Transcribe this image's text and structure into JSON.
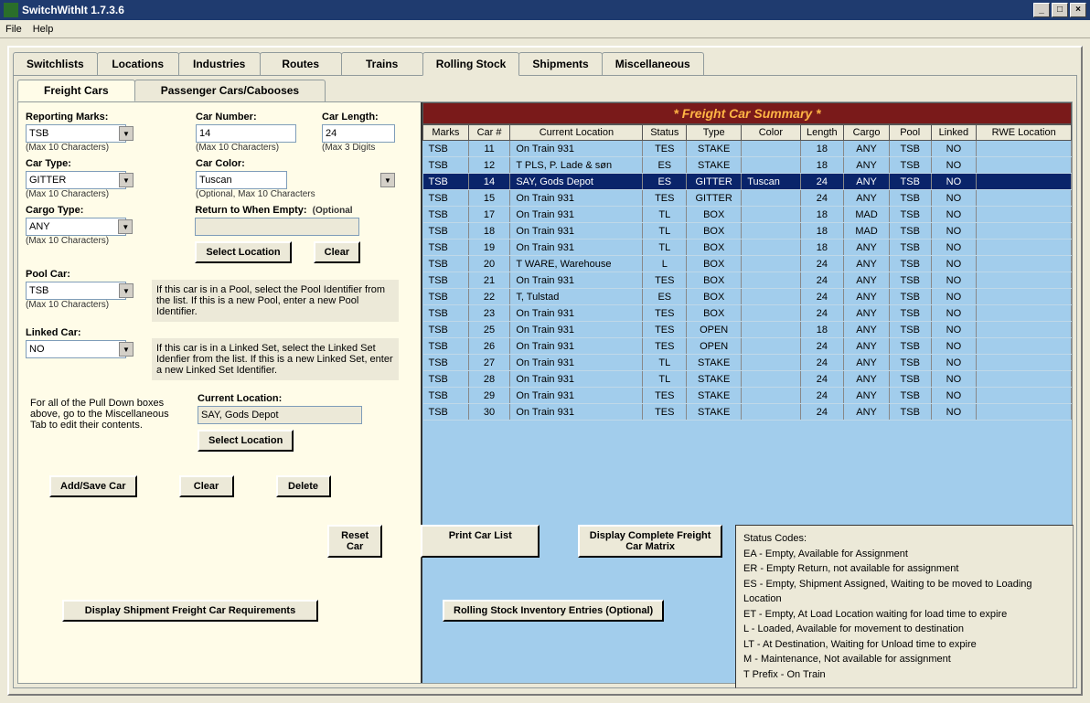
{
  "window": {
    "title": "SwitchWithIt 1.7.3.6",
    "menus": [
      "File",
      "Help"
    ]
  },
  "tabs_main": [
    "Switchlists",
    "Locations",
    "Industries",
    "Routes",
    "Trains",
    "Rolling Stock",
    "Shipments",
    "Miscellaneous"
  ],
  "tabs_main_active": "Rolling Stock",
  "tabs_sub": [
    "Freight Cars",
    "Passenger Cars/Cabooses"
  ],
  "tabs_sub_active": "Freight Cars",
  "form": {
    "reporting_marks": {
      "label": "Reporting Marks:",
      "value": "TSB",
      "hint": "(Max 10 Characters)"
    },
    "car_number": {
      "label": "Car Number:",
      "value": "14",
      "hint": "(Max 10 Characters)"
    },
    "car_length": {
      "label": "Car Length:",
      "value": "24",
      "hint": "(Max 3 Digits"
    },
    "car_type": {
      "label": "Car Type:",
      "value": "GITTER",
      "hint": "(Max 10 Characters)"
    },
    "car_color": {
      "label": "Car Color:",
      "value": "Tuscan",
      "hint": "(Optional, Max 10 Characters"
    },
    "cargo_type": {
      "label": "Cargo Type:",
      "value": "ANY",
      "hint": "(Max 10 Characters)"
    },
    "return_empty": {
      "label": "Return to When Empty:",
      "hint": "(Optional",
      "value": ""
    },
    "select_location": "Select Location",
    "clear": "Clear",
    "pool_car": {
      "label": "Pool Car:",
      "value": "TSB",
      "hint": "(Max 10 Characters)",
      "help": "If this car is in a Pool, select the Pool Identifier from the list.  If this is a new Pool, enter a new Pool Identifier."
    },
    "linked_car": {
      "label": "Linked Car:",
      "value": "NO",
      "help": "If this car is in a Linked Set, select the Linked Set Idenfier from the list.  If this is a new Linked Set, enter a new Linked Set Identifier."
    },
    "pulldown_help": "For all of the Pull Down boxes above, go to the Miscellaneous Tab to edit their contents.",
    "current_location": {
      "label": "Current Location:",
      "value": "SAY, Gods Depot"
    },
    "select_location2": "Select Location",
    "add_save": "Add/Save Car",
    "clear2": "Clear",
    "delete": "Delete"
  },
  "summary": {
    "title": "* Freight Car Summary *",
    "headers": [
      "Marks",
      "Car #",
      "Current Location",
      "Status",
      "Type",
      "Color",
      "Length",
      "Cargo",
      "Pool",
      "Linked",
      "RWE Location"
    ],
    "selected": 2,
    "rows": [
      [
        "TSB",
        "11",
        "On Train 931",
        "TES",
        "STAKE",
        "",
        "18",
        "ANY",
        "TSB",
        "NO",
        ""
      ],
      [
        "TSB",
        "12",
        "T PLS, P. Lade & søn",
        "ES",
        "STAKE",
        "",
        "18",
        "ANY",
        "TSB",
        "NO",
        ""
      ],
      [
        "TSB",
        "14",
        "SAY, Gods Depot",
        "ES",
        "GITTER",
        "Tuscan",
        "24",
        "ANY",
        "TSB",
        "NO",
        ""
      ],
      [
        "TSB",
        "15",
        "On Train 931",
        "TES",
        "GITTER",
        "",
        "24",
        "ANY",
        "TSB",
        "NO",
        ""
      ],
      [
        "TSB",
        "17",
        "On Train 931",
        "TL",
        "BOX",
        "",
        "18",
        "MAD",
        "TSB",
        "NO",
        ""
      ],
      [
        "TSB",
        "18",
        "On Train 931",
        "TL",
        "BOX",
        "",
        "18",
        "MAD",
        "TSB",
        "NO",
        ""
      ],
      [
        "TSB",
        "19",
        "On Train 931",
        "TL",
        "BOX",
        "",
        "18",
        "ANY",
        "TSB",
        "NO",
        ""
      ],
      [
        "TSB",
        "20",
        "T WARE, Warehouse",
        "L",
        "BOX",
        "",
        "24",
        "ANY",
        "TSB",
        "NO",
        ""
      ],
      [
        "TSB",
        "21",
        "On Train 931",
        "TES",
        "BOX",
        "",
        "24",
        "ANY",
        "TSB",
        "NO",
        ""
      ],
      [
        "TSB",
        "22",
        "T, Tulstad",
        "ES",
        "BOX",
        "",
        "24",
        "ANY",
        "TSB",
        "NO",
        ""
      ],
      [
        "TSB",
        "23",
        "On Train 931",
        "TES",
        "BOX",
        "",
        "24",
        "ANY",
        "TSB",
        "NO",
        ""
      ],
      [
        "TSB",
        "25",
        "On Train 931",
        "TES",
        "OPEN",
        "",
        "18",
        "ANY",
        "TSB",
        "NO",
        ""
      ],
      [
        "TSB",
        "26",
        "On Train 931",
        "TES",
        "OPEN",
        "",
        "24",
        "ANY",
        "TSB",
        "NO",
        ""
      ],
      [
        "TSB",
        "27",
        "On Train 931",
        "TL",
        "STAKE",
        "",
        "24",
        "ANY",
        "TSB",
        "NO",
        ""
      ],
      [
        "TSB",
        "28",
        "On Train 931",
        "TL",
        "STAKE",
        "",
        "24",
        "ANY",
        "TSB",
        "NO",
        ""
      ],
      [
        "TSB",
        "29",
        "On Train 931",
        "TES",
        "STAKE",
        "",
        "24",
        "ANY",
        "TSB",
        "NO",
        ""
      ],
      [
        "TSB",
        "30",
        "On Train 931",
        "TES",
        "STAKE",
        "",
        "24",
        "ANY",
        "TSB",
        "NO",
        ""
      ]
    ]
  },
  "bottom": {
    "reset_car": "Reset Car",
    "print": "Print Car List",
    "display_matrix": "Display Complete Freight Car Matrix",
    "display_req": "Display Shipment Freight Car Requirements",
    "rolling_inv": "Rolling Stock Inventory Entries (Optional)"
  },
  "status_codes": {
    "title": "Status Codes:",
    "lines": [
      "EA - Empty, Available for Assignment",
      "ER - Empty Return, not available for assignment",
      "ES - Empty, Shipment Assigned, Waiting to be moved to Loading Location",
      "ET - Empty, At Load Location waiting for load time to expire",
      "L - Loaded, Available for movement to destination",
      "LT - At Destination, Waiting for Unload time to expire",
      "M - Maintenance, Not available for assignment",
      "T Prefix - On Train"
    ]
  }
}
